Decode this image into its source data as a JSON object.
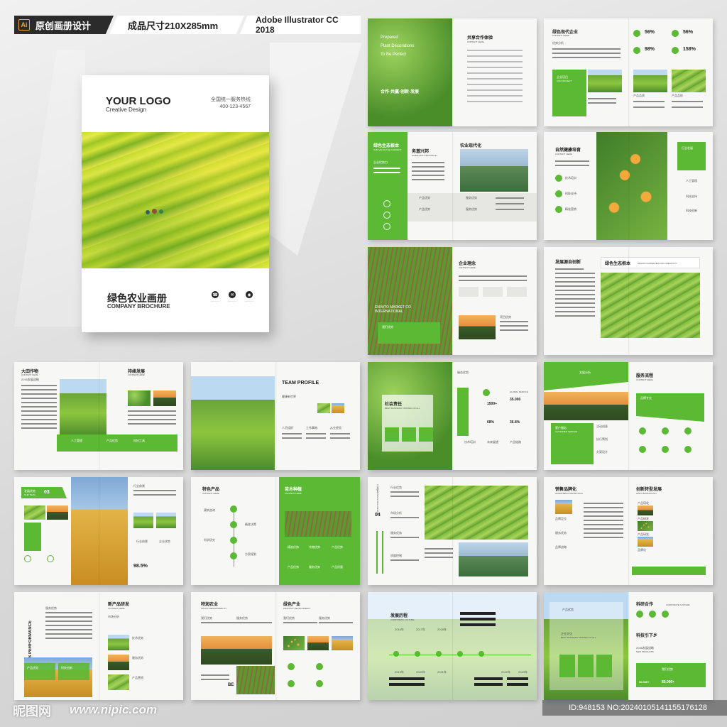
{
  "topbar": {
    "badge": "Ai",
    "brand": "原创画册设计",
    "size": "成品尺寸210X285mm",
    "software": "Adobe Illustrator CC 2018"
  },
  "cover": {
    "logo": "YOUR LOGO",
    "logo_sub": "Creative Design",
    "hotline_label": "全国统一服务热线",
    "hotline": "400-123-4567",
    "title": "绿色农业画册",
    "title_en": "COMPANY BROCHURE",
    "icons": [
      "phone-icon",
      "mail-icon",
      "wechat-icon"
    ]
  },
  "spreads": {
    "s1": {
      "en1": "Prepared",
      "en2": "Plant Decorations",
      "en3": "To Be Perfect",
      "slogan": "合作·共赢·创新·发展",
      "title": "共享合作体验",
      "sub": "CONTENT HERE"
    },
    "s2": {
      "title": "绿色现代企业",
      "sub": "CONTENT HERE",
      "analysis": "优势分析",
      "project": "企业项目",
      "project_en": "OUR PROJECT",
      "stats": [
        "56%",
        "56%",
        "98%",
        "158%"
      ],
      "labels": [
        "产品品质",
        "产品品质",
        "产品品质"
      ]
    },
    "s3": {
      "title": "绿色生态根本",
      "en": "OUR VALUE THE CURRENT",
      "t2": "务基兴邦",
      "t2en": "SCIENTIFIC INNOVATION",
      "t3": "农业现代化",
      "side": "企业优势力",
      "i1": "产品优势",
      "i2": "服务优势",
      "i3": "产品优势",
      "i4": "服务优势"
    },
    "s4": {
      "title": "自然健康培育",
      "sub": "CONTENT HERE",
      "tag": "行业发展",
      "items": [
        "技术培训",
        "科技支持",
        "精准营销"
      ],
      "items2": [
        "人工管理",
        "科技支持",
        "科技创新"
      ]
    },
    "s5": {
      "en": "ENVATO MARKET CO INTERNATIONAL",
      "tag": "我们优势",
      "title": "企业理念",
      "sub": "CONTENT HERE",
      "t2": "项目优势"
    },
    "s6": {
      "title": "发展源自创新",
      "t2": "绿色生态根本",
      "t2en": "DESIGN GUIDELINES FOR CREATIVITY"
    },
    "s7": {
      "title": "大田作物",
      "sub": "CONTENT HERE",
      "year": "2035发展战略",
      "t2": "持续发展",
      "t2sub": "CONTENT HERE",
      "b1": "人工管理",
      "b2": "产品优势",
      "b3": "科技工具"
    },
    "s8": {
      "title": "TEAM PROFILE",
      "sub": "健康新世界",
      "i1": "人员组织",
      "i2": "工作事物",
      "i3": "从业经验"
    },
    "s9": {
      "tag": "服务优势",
      "title": "社会责任",
      "sub": "BEST BUSINESS STRATEG OF ALL",
      "vert": "RESPONSIBLE FOR PROMOTING NETWORK OF LIFE",
      "stats": [
        "1500+",
        "35.000",
        "68%",
        "36.8%"
      ],
      "slabels": [
        "GLOBAL SERVICE",
        "方案研究",
        "产品质量",
        "产品质量"
      ],
      "b1": "技术培训",
      "b2": "未来展望",
      "b3": "产品链路"
    },
    "s10": {
      "tag": "发展分析",
      "title": "服务流程",
      "sub": "CONTENT HERE",
      "t2": "品牌专业",
      "t3": "客户服务",
      "t3en": "CUSTOMER SERVICE",
      "items": [
        "活动创意",
        "执行策划",
        "方案设计"
      ]
    },
    "s11": {
      "tag": "发展优势",
      "tagen": "OUR TEAM",
      "num": "03",
      "t2": "行业前景",
      "i1": "行业前景",
      "i2": "企业优势",
      "pct": "98.5%"
    },
    "s12": {
      "title": "特色产品",
      "sub": "CONTENT HERE",
      "t2": "苗木种植",
      "t2sub": "CONTENT HERE",
      "nodes": [
        "建筑咨询",
        "精准决策",
        "科学研究",
        "方案规划"
      ],
      "items": [
        "精准优势",
        "作物优势",
        "产品优势",
        "产品优势",
        "服务优势",
        "产品质量"
      ]
    },
    "s13": {
      "num": "04",
      "vert": "工业研发 INDUSTRIAL DESIGN",
      "title": "行业优势",
      "items": [
        "市场分析",
        "服务优势",
        "质量控制"
      ]
    },
    "s14": {
      "title": "销售品牌化",
      "sub": "INVESTMENT PROMOTION",
      "t2": "创新转型发展",
      "t2sub": "HIGH TECHNOLOGY",
      "items": [
        "品牌定位",
        "服务优势",
        "品牌战略"
      ],
      "right": [
        "产品研发",
        "产品研发",
        "产品研发",
        "品牌化"
      ]
    },
    "s15": {
      "vert": "SALES PERFORMANCE",
      "t1": "服务优势",
      "t2": "新产品研发",
      "t2sub": "CONTENT HERE",
      "items": [
        "市场分析",
        "技术优势",
        "服务优势",
        "产品营销"
      ],
      "b1": "产品优势",
      "b2": "科技创新"
    },
    "s16": {
      "title": "特润农业",
      "sub": "SOCIAL RESPONSIBILITY",
      "i1": "我们优势",
      "i2": "服务优势",
      "t2": "绿色产业",
      "t2sub": "PRODUCT DEVELOPMENT",
      "i3": "我们优势",
      "i4": "服务优势",
      "tag": "BE"
    },
    "s17": {
      "title": "发展历程",
      "sub": "CORPORATE CULTURE",
      "years": [
        "2016年",
        "2017年",
        "2018年",
        "2019年",
        "2020年",
        "2021年",
        "2022年",
        "2023年"
      ]
    },
    "s18": {
      "t1": "产品优势",
      "t2": "企业文化",
      "t2en": "BEST BUSINESS STRATEG OF ALL",
      "t3": "科研合作",
      "t3sub": "CORPORATE CULTURE",
      "t4": "科技引下乡",
      "year": "2036发展战略",
      "new": "NEW PRODUCTS",
      "n1": "30.000+",
      "n2": "85.000+",
      "btn": "我们优势"
    }
  },
  "watermark": {
    "logo": "昵图网",
    "url": "www.nipic.com",
    "id": "ID:948153 NO:20240105141155176128"
  }
}
